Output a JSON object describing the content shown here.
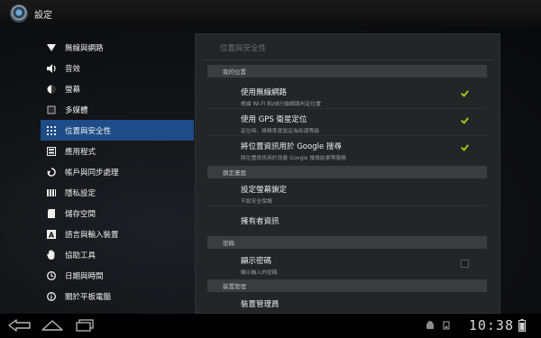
{
  "app": {
    "title": "設定"
  },
  "menu": {
    "items": [
      {
        "label": "無線與網路",
        "icon": "wifi-icon",
        "active": false
      },
      {
        "label": "音效",
        "icon": "speaker-icon",
        "active": false
      },
      {
        "label": "螢幕",
        "icon": "brightness-icon",
        "active": false
      },
      {
        "label": "多媒體",
        "icon": "media-icon",
        "active": false
      },
      {
        "label": "位置與安全性",
        "icon": "grid-lock-icon",
        "active": true
      },
      {
        "label": "應用程式",
        "icon": "apps-icon",
        "active": false
      },
      {
        "label": "帳戶與同步處理",
        "icon": "sync-icon",
        "active": false
      },
      {
        "label": "隱私設定",
        "icon": "privacy-icon",
        "active": false
      },
      {
        "label": "儲存空間",
        "icon": "storage-icon",
        "active": false
      },
      {
        "label": "語言與輸入裝置",
        "icon": "language-icon",
        "active": false
      },
      {
        "label": "協助工具",
        "icon": "hand-icon",
        "active": false
      },
      {
        "label": "日期與時間",
        "icon": "clock-icon",
        "active": false
      },
      {
        "label": "關於平板電腦",
        "icon": "info-icon",
        "active": false
      }
    ]
  },
  "panel": {
    "title": "位置與安全性",
    "sections": {
      "my_location": "我的位置",
      "screen_unlock": "鎖定畫面",
      "passwords": "密碼",
      "device_admin": "裝置管理"
    },
    "prefs": {
      "wireless": {
        "title": "使用無線網路",
        "summary": "根據 Wi-Fi 和/或行動網路判定位置",
        "checked": true
      },
      "gps": {
        "title": "使用 GPS 衛星定位",
        "summary": "定位時，將精準度設定為街道等級",
        "checked": true
      },
      "google_search": {
        "title": "將位置資訊用於 Google 搜尋",
        "summary": "將位置資訊用於改善 Google 搜尋結果等服務",
        "checked": true
      },
      "screen_lock": {
        "title": "設定螢幕鎖定",
        "summary": "不設安全保護"
      },
      "owner_info": {
        "title": "擁有者資訊"
      },
      "show_password": {
        "title": "顯示密碼",
        "summary": "顯示輸入的密碼",
        "checked": false
      },
      "device_admins": {
        "title": "裝置管理員"
      }
    }
  },
  "statusbar": {
    "time": "10:38"
  },
  "colors": {
    "accent": "#1e4c88",
    "check": "#a2c614"
  }
}
